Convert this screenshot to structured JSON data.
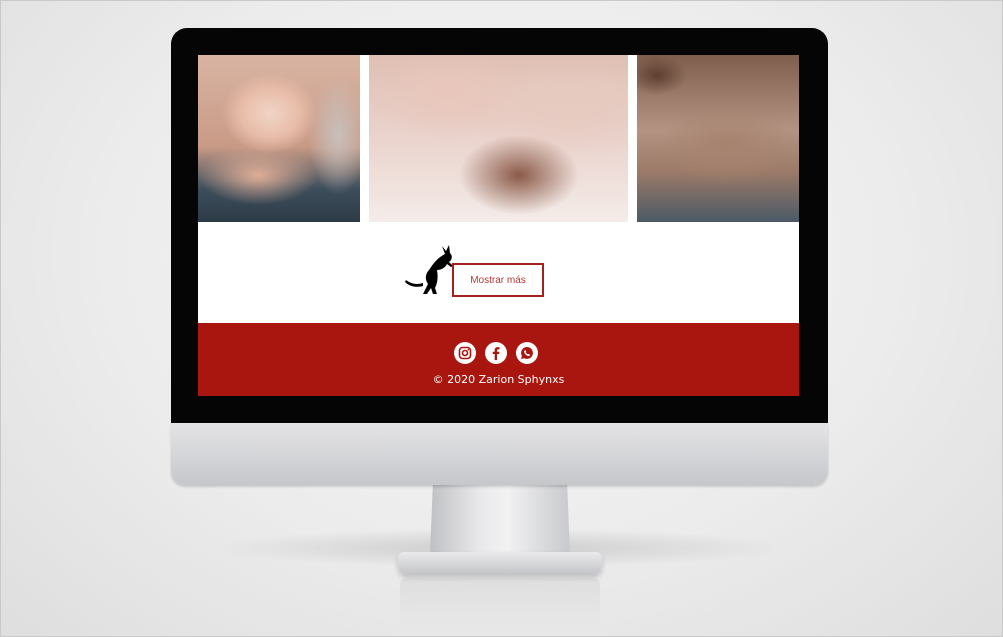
{
  "page": {
    "more_button_label": "Mostrar más",
    "copyright": "© 2020 Zarion Sphynxs"
  },
  "colors": {
    "accent": "#a8160f",
    "button_border": "#a7201b",
    "monitor_bezel": "#050505"
  },
  "gallery": [
    {
      "icon": "sphynx-kitten-photo"
    },
    {
      "icon": "sphynx-sleeping-photo"
    },
    {
      "icon": "sphynx-skin-closeup-photo"
    }
  ],
  "social_icons": [
    "instagram-icon",
    "facebook-icon",
    "whatsapp-icon"
  ]
}
